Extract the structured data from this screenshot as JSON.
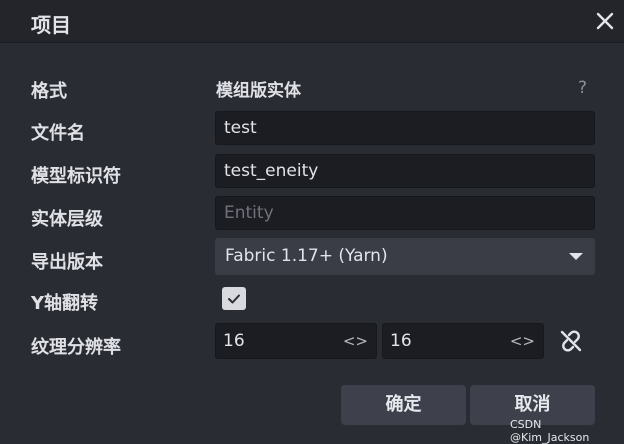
{
  "dialog": {
    "title": "项目"
  },
  "form": {
    "format": {
      "label": "格式",
      "value": "模组版实体",
      "help": "?"
    },
    "filename": {
      "label": "文件名",
      "value": "test"
    },
    "model_id": {
      "label": "模型标识符",
      "value": "test_eneity"
    },
    "entity_layer": {
      "label": "实体层级",
      "value": "",
      "placeholder": "Entity"
    },
    "export_version": {
      "label": "导出版本",
      "value": "Fabric 1.17+ (Yarn)"
    },
    "y_flip": {
      "label": "Y轴翻转",
      "checked": true
    },
    "texture_resolution": {
      "label": "纹理分辨率",
      "width": "16",
      "height": "16",
      "drag_glyph": "<>"
    }
  },
  "buttons": {
    "confirm": "确定",
    "cancel": "取消"
  },
  "watermark": "CSDN @Kim_Jackson",
  "colors": {
    "background": "#2a2c33",
    "input_background": "#1c1d22",
    "button_background": "#3e414b"
  }
}
